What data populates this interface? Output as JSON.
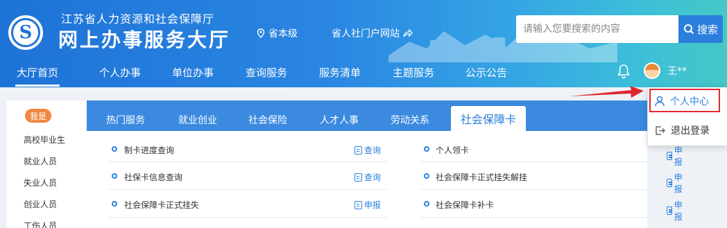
{
  "header": {
    "org_name": "江苏省人力资源和社会保障厅",
    "hall_name": "网上办事服务大厅",
    "region": "省本级",
    "portal_link": "省人社门户网站",
    "search_placeholder": "请输入您要搜索的内容",
    "search_button": "搜索",
    "username": "王**"
  },
  "nav": {
    "items": [
      "大厅首页",
      "个人办事",
      "单位办事",
      "查询服务",
      "服务清单",
      "主题服务",
      "公示公告"
    ],
    "active_index": 0
  },
  "sidebar": {
    "badge": "我是",
    "items": [
      "高校毕业生",
      "就业人员",
      "失业人员",
      "创业人员",
      "工伤人员"
    ]
  },
  "tabs": {
    "items": [
      "热门服务",
      "就业创业",
      "社会保险",
      "人才人事",
      "劳动关系",
      "社会保障卡"
    ],
    "active_index": 5
  },
  "services": {
    "left": [
      {
        "label": "制卡进度查询",
        "action": "查询"
      },
      {
        "label": "社保卡信息查询",
        "action": "查询"
      },
      {
        "label": "社会保障卡正式挂失",
        "action": "申报"
      }
    ],
    "right": [
      {
        "label": "个人领卡",
        "action": "申报"
      },
      {
        "label": "社会保障卡正式挂失解挂",
        "action": "申报"
      },
      {
        "label": "社会保障卡补卡",
        "action": "申报"
      }
    ]
  },
  "dropdown": {
    "items": [
      "个人中心",
      "退出登录"
    ],
    "highlighted_index": 0
  },
  "colors": {
    "primary": "#2a7fdc",
    "badge": "#f08640",
    "highlight": "#e0262d"
  }
}
